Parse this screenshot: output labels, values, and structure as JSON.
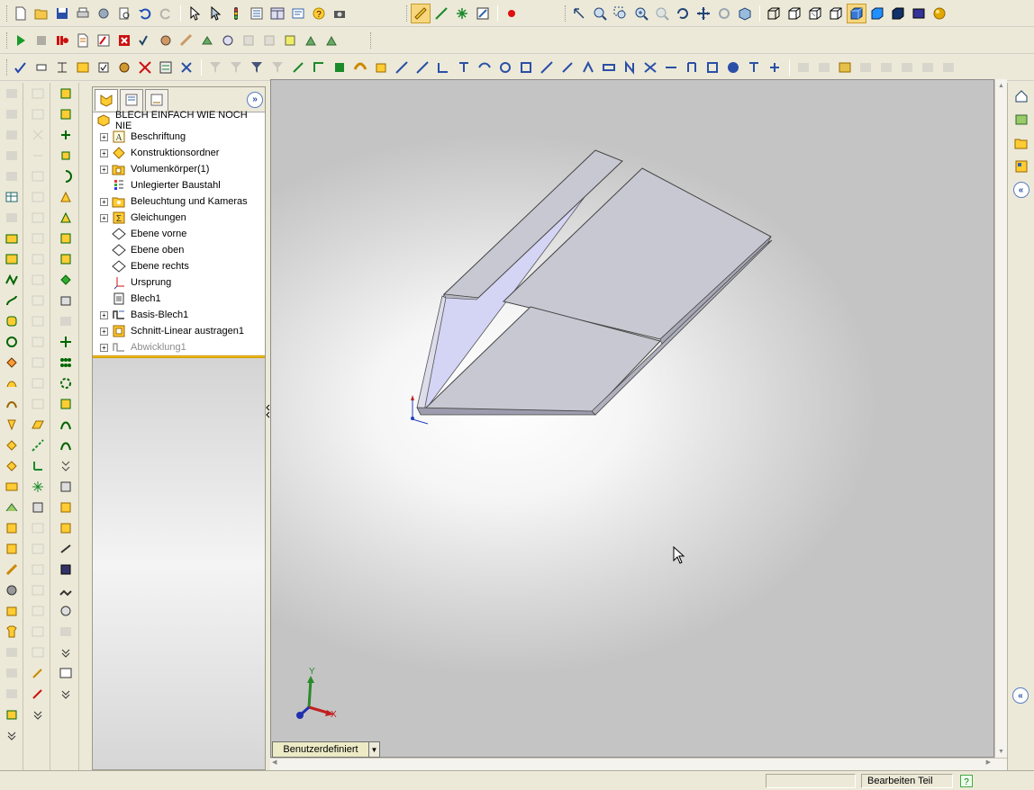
{
  "toolbar_standard": [
    {
      "name": "new-document-icon"
    },
    {
      "name": "open-folder-icon"
    },
    {
      "name": "save-icon"
    },
    {
      "name": "print-icon"
    },
    {
      "name": "options-icon"
    },
    {
      "name": "print-preview-icon"
    },
    {
      "name": "undo-icon"
    },
    {
      "name": "redo-icon"
    },
    {
      "name": "select-icon"
    },
    {
      "name": "select-filter-icon"
    },
    {
      "name": "rebuild-icon"
    },
    {
      "name": "file-properties-icon"
    },
    {
      "name": "view-layout-icon"
    },
    {
      "name": "insert-object-icon"
    },
    {
      "name": "help-icon"
    },
    {
      "name": "camera-icon"
    }
  ],
  "toolbar_view": [
    {
      "name": "previous-view-icon"
    },
    {
      "name": "zoom-to-fit-icon"
    },
    {
      "name": "zoom-to-area-icon"
    },
    {
      "name": "zoom-in-out-icon"
    },
    {
      "name": "zoom-to-selection-icon"
    },
    {
      "name": "rotate-icon"
    },
    {
      "name": "pan-icon"
    },
    {
      "name": "roll-view-icon"
    },
    {
      "name": "standard-views-icon"
    },
    {
      "name": "wireframe-icon"
    },
    {
      "name": "hidden-lines-visible-icon"
    },
    {
      "name": "hidden-lines-removed-icon"
    },
    {
      "name": "shaded-with-edges-icon"
    },
    {
      "name": "shaded-icon"
    },
    {
      "name": "shadows-icon"
    },
    {
      "name": "section-view-icon"
    },
    {
      "name": "realview-icon"
    },
    {
      "name": "appearance-sphere-icon"
    }
  ],
  "toolbar_macro": [
    {
      "name": "run-macro-icon"
    },
    {
      "name": "stop-macro-icon"
    },
    {
      "name": "record-pause-icon"
    },
    {
      "name": "new-macro-icon"
    },
    {
      "name": "edit-macro-icon"
    },
    {
      "name": "excel-icon"
    },
    {
      "name": "check-icon"
    },
    {
      "name": "tool-icon"
    }
  ],
  "feature_manager": {
    "root": "BLECH EINFACH WIE NOCH NIE",
    "items": [
      {
        "label": "Beschriftung",
        "expandable": true,
        "icon": "annotations-icon",
        "suppressed": false
      },
      {
        "label": "Konstruktionsordner",
        "expandable": true,
        "icon": "design-folder-icon",
        "suppressed": false
      },
      {
        "label": "Volumenkörper(1)",
        "expandable": true,
        "icon": "solid-bodies-folder-icon",
        "suppressed": false
      },
      {
        "label": "Unlegierter Baustahl",
        "expandable": false,
        "icon": "material-icon",
        "suppressed": false
      },
      {
        "label": "Beleuchtung und Kameras",
        "expandable": true,
        "icon": "lights-cameras-icon",
        "suppressed": false
      },
      {
        "label": "Gleichungen",
        "expandable": true,
        "icon": "equations-icon",
        "suppressed": false
      },
      {
        "label": "Ebene vorne",
        "expandable": false,
        "icon": "plane-icon",
        "suppressed": false
      },
      {
        "label": "Ebene oben",
        "expandable": false,
        "icon": "plane-icon",
        "suppressed": false
      },
      {
        "label": "Ebene rechts",
        "expandable": false,
        "icon": "plane-icon",
        "suppressed": false
      },
      {
        "label": "Ursprung",
        "expandable": false,
        "icon": "origin-icon",
        "suppressed": false
      },
      {
        "label": "Blech1",
        "expandable": false,
        "icon": "sheet-metal-icon",
        "suppressed": false
      },
      {
        "label": "Basis-Blech1",
        "expandable": true,
        "icon": "base-flange-icon",
        "suppressed": false
      },
      {
        "label": "Schnitt-Linear austragen1",
        "expandable": true,
        "icon": "cut-extrude-icon",
        "suppressed": false
      },
      {
        "label": "Abwicklung1",
        "expandable": true,
        "icon": "flat-pattern-icon",
        "suppressed": true
      }
    ]
  },
  "viewport": {
    "configuration_tab": "Benutzerdefiniert",
    "triad": {
      "x": "X",
      "y": "Y"
    }
  },
  "status": {
    "mode": "Bearbeiten Teil",
    "help": "?"
  },
  "colors": {
    "part_face": "#c8c8d2",
    "part_inner": "#d4d4f4",
    "rollback_bar": "#f0c020"
  }
}
